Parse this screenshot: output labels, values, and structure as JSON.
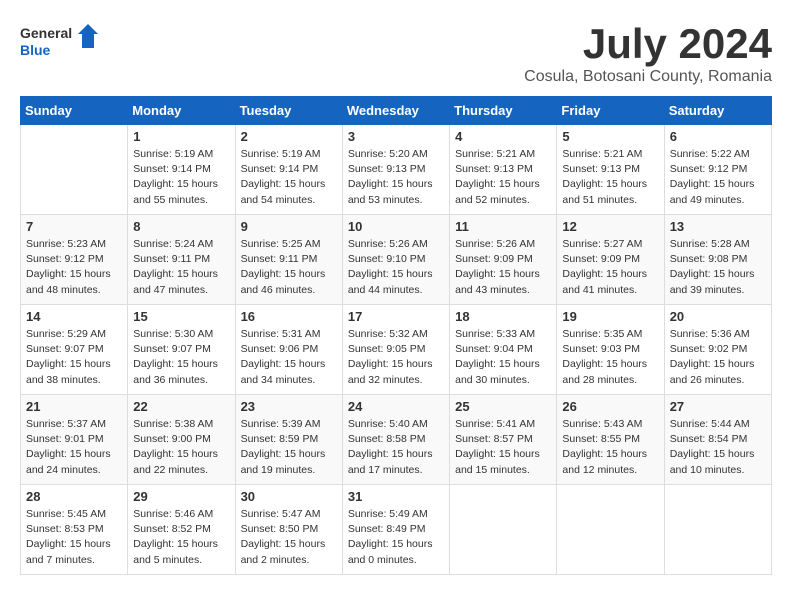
{
  "header": {
    "logo_general": "General",
    "logo_blue": "Blue",
    "month": "July 2024",
    "location": "Cosula, Botosani County, Romania"
  },
  "calendar": {
    "days_of_week": [
      "Sunday",
      "Monday",
      "Tuesday",
      "Wednesday",
      "Thursday",
      "Friday",
      "Saturday"
    ],
    "weeks": [
      [
        {
          "day": "",
          "info": ""
        },
        {
          "day": "1",
          "info": "Sunrise: 5:19 AM\nSunset: 9:14 PM\nDaylight: 15 hours\nand 55 minutes."
        },
        {
          "day": "2",
          "info": "Sunrise: 5:19 AM\nSunset: 9:14 PM\nDaylight: 15 hours\nand 54 minutes."
        },
        {
          "day": "3",
          "info": "Sunrise: 5:20 AM\nSunset: 9:13 PM\nDaylight: 15 hours\nand 53 minutes."
        },
        {
          "day": "4",
          "info": "Sunrise: 5:21 AM\nSunset: 9:13 PM\nDaylight: 15 hours\nand 52 minutes."
        },
        {
          "day": "5",
          "info": "Sunrise: 5:21 AM\nSunset: 9:13 PM\nDaylight: 15 hours\nand 51 minutes."
        },
        {
          "day": "6",
          "info": "Sunrise: 5:22 AM\nSunset: 9:12 PM\nDaylight: 15 hours\nand 49 minutes."
        }
      ],
      [
        {
          "day": "7",
          "info": "Sunrise: 5:23 AM\nSunset: 9:12 PM\nDaylight: 15 hours\nand 48 minutes."
        },
        {
          "day": "8",
          "info": "Sunrise: 5:24 AM\nSunset: 9:11 PM\nDaylight: 15 hours\nand 47 minutes."
        },
        {
          "day": "9",
          "info": "Sunrise: 5:25 AM\nSunset: 9:11 PM\nDaylight: 15 hours\nand 46 minutes."
        },
        {
          "day": "10",
          "info": "Sunrise: 5:26 AM\nSunset: 9:10 PM\nDaylight: 15 hours\nand 44 minutes."
        },
        {
          "day": "11",
          "info": "Sunrise: 5:26 AM\nSunset: 9:09 PM\nDaylight: 15 hours\nand 43 minutes."
        },
        {
          "day": "12",
          "info": "Sunrise: 5:27 AM\nSunset: 9:09 PM\nDaylight: 15 hours\nand 41 minutes."
        },
        {
          "day": "13",
          "info": "Sunrise: 5:28 AM\nSunset: 9:08 PM\nDaylight: 15 hours\nand 39 minutes."
        }
      ],
      [
        {
          "day": "14",
          "info": "Sunrise: 5:29 AM\nSunset: 9:07 PM\nDaylight: 15 hours\nand 38 minutes."
        },
        {
          "day": "15",
          "info": "Sunrise: 5:30 AM\nSunset: 9:07 PM\nDaylight: 15 hours\nand 36 minutes."
        },
        {
          "day": "16",
          "info": "Sunrise: 5:31 AM\nSunset: 9:06 PM\nDaylight: 15 hours\nand 34 minutes."
        },
        {
          "day": "17",
          "info": "Sunrise: 5:32 AM\nSunset: 9:05 PM\nDaylight: 15 hours\nand 32 minutes."
        },
        {
          "day": "18",
          "info": "Sunrise: 5:33 AM\nSunset: 9:04 PM\nDaylight: 15 hours\nand 30 minutes."
        },
        {
          "day": "19",
          "info": "Sunrise: 5:35 AM\nSunset: 9:03 PM\nDaylight: 15 hours\nand 28 minutes."
        },
        {
          "day": "20",
          "info": "Sunrise: 5:36 AM\nSunset: 9:02 PM\nDaylight: 15 hours\nand 26 minutes."
        }
      ],
      [
        {
          "day": "21",
          "info": "Sunrise: 5:37 AM\nSunset: 9:01 PM\nDaylight: 15 hours\nand 24 minutes."
        },
        {
          "day": "22",
          "info": "Sunrise: 5:38 AM\nSunset: 9:00 PM\nDaylight: 15 hours\nand 22 minutes."
        },
        {
          "day": "23",
          "info": "Sunrise: 5:39 AM\nSunset: 8:59 PM\nDaylight: 15 hours\nand 19 minutes."
        },
        {
          "day": "24",
          "info": "Sunrise: 5:40 AM\nSunset: 8:58 PM\nDaylight: 15 hours\nand 17 minutes."
        },
        {
          "day": "25",
          "info": "Sunrise: 5:41 AM\nSunset: 8:57 PM\nDaylight: 15 hours\nand 15 minutes."
        },
        {
          "day": "26",
          "info": "Sunrise: 5:43 AM\nSunset: 8:55 PM\nDaylight: 15 hours\nand 12 minutes."
        },
        {
          "day": "27",
          "info": "Sunrise: 5:44 AM\nSunset: 8:54 PM\nDaylight: 15 hours\nand 10 minutes."
        }
      ],
      [
        {
          "day": "28",
          "info": "Sunrise: 5:45 AM\nSunset: 8:53 PM\nDaylight: 15 hours\nand 7 minutes."
        },
        {
          "day": "29",
          "info": "Sunrise: 5:46 AM\nSunset: 8:52 PM\nDaylight: 15 hours\nand 5 minutes."
        },
        {
          "day": "30",
          "info": "Sunrise: 5:47 AM\nSunset: 8:50 PM\nDaylight: 15 hours\nand 2 minutes."
        },
        {
          "day": "31",
          "info": "Sunrise: 5:49 AM\nSunset: 8:49 PM\nDaylight: 15 hours\nand 0 minutes."
        },
        {
          "day": "",
          "info": ""
        },
        {
          "day": "",
          "info": ""
        },
        {
          "day": "",
          "info": ""
        }
      ]
    ]
  }
}
